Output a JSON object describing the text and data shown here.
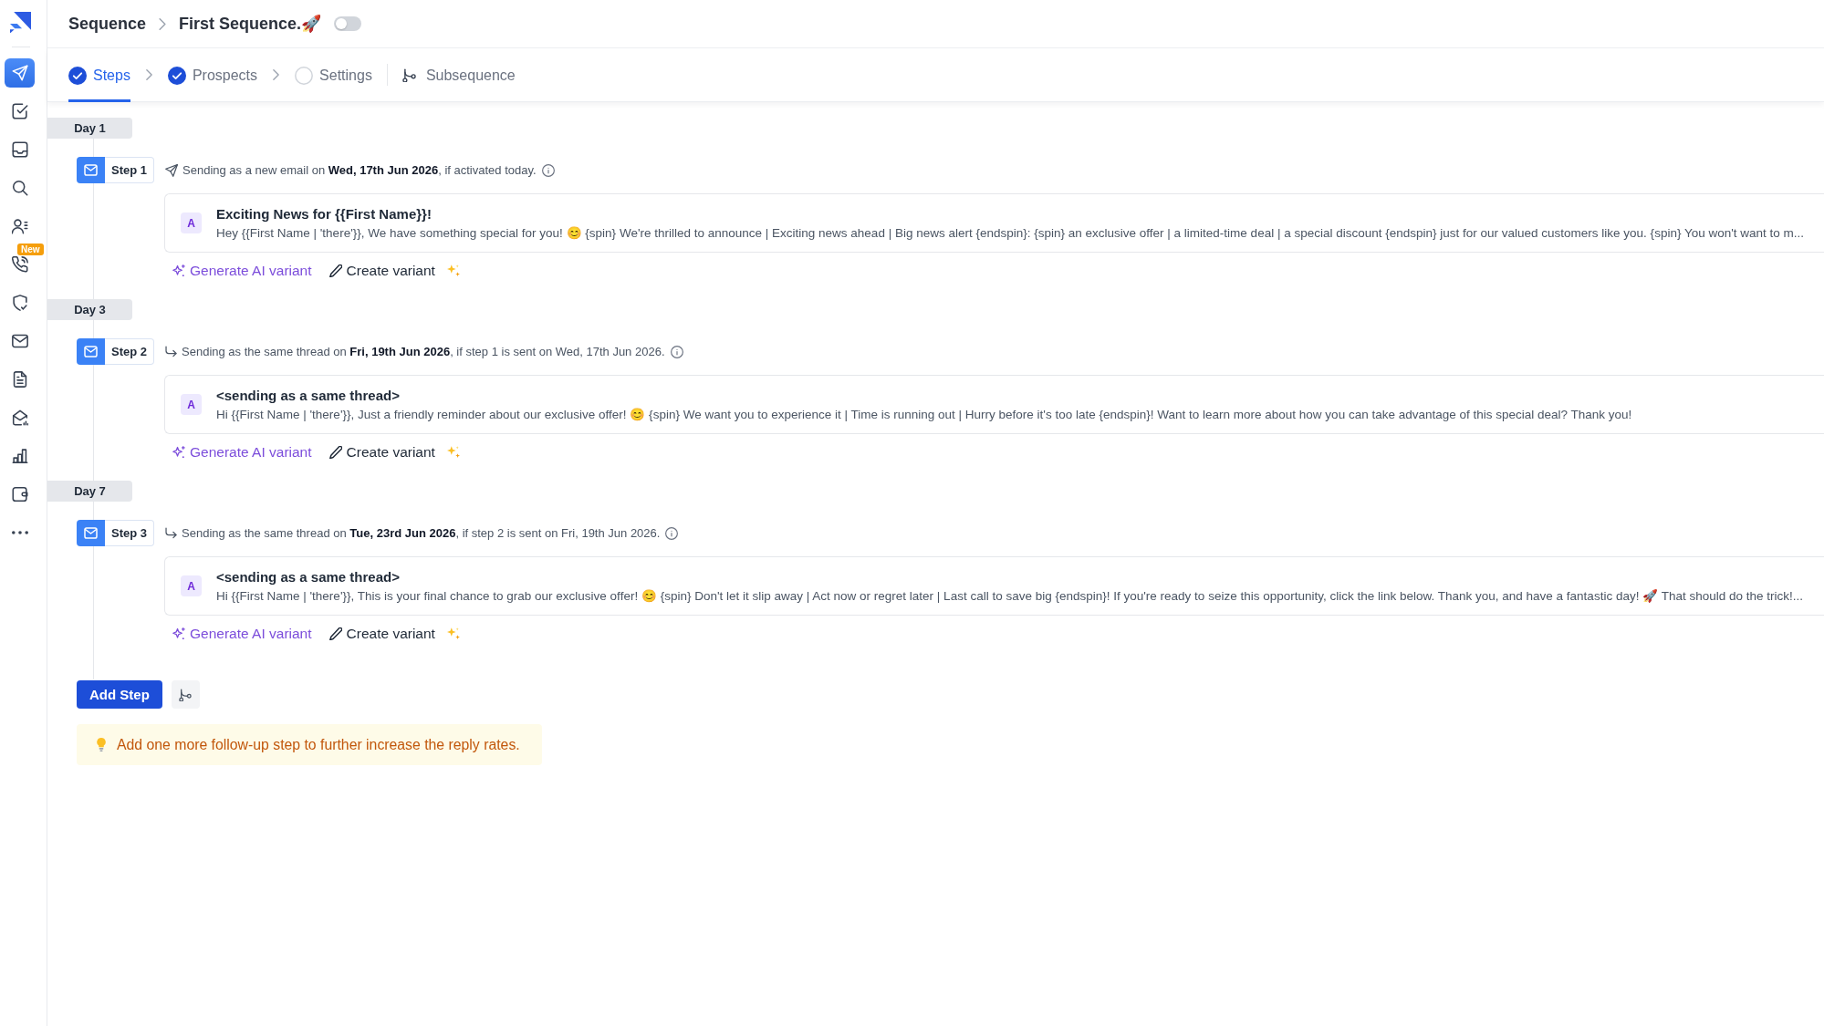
{
  "sidebar": {
    "items": [
      {
        "selected": true
      },
      {
        "selected": false
      },
      {
        "selected": false
      },
      {
        "selected": false
      },
      {
        "selected": false
      },
      {
        "selected": false,
        "badge": "New"
      },
      {
        "selected": false
      },
      {
        "selected": false
      },
      {
        "selected": false
      },
      {
        "selected": false
      },
      {
        "selected": false
      },
      {
        "selected": false
      },
      {
        "selected": false
      }
    ]
  },
  "header": {
    "breadcrumb": [
      "Sequence",
      "First Sequence.🚀"
    ],
    "toggle": {
      "on": false
    }
  },
  "tabs": [
    {
      "kind": "step",
      "label": "Steps",
      "completed": true,
      "selected": true
    },
    {
      "kind": "step",
      "label": "Prospects",
      "completed": true,
      "selected": false
    },
    {
      "kind": "step",
      "label": "Settings",
      "completed": false,
      "selected": false
    },
    {
      "kind": "subsequence",
      "label": "Subsequence",
      "selected": false
    }
  ],
  "days": [
    {
      "label": "Day 1",
      "step": {
        "label": "Step 1",
        "schedule": {
          "kind": "new_email",
          "text": "Sending as a new email on **Wed, 17th Jun 2026**, if activated today."
        },
        "variant": {
          "label": "A",
          "subject": "Exciting News for {{First Name}}!",
          "body": "Hey {{First Name | 'there'}}, We have something special for you! 😊 {spin} We're thrilled to announce | Exciting news ahead | Big news alert {endspin}: {spin} an exclusive offer | a limited-time deal | a special discount {endspin} just for our valued customers like you. {spin} You won't want to m..."
        },
        "actions": [
          {
            "kind": "ai",
            "label": "Generate AI variant"
          },
          {
            "kind": "manual",
            "label": "Create variant"
          }
        ]
      }
    },
    {
      "label": "Day 3",
      "step": {
        "label": "Step 2",
        "schedule": {
          "kind": "same_thread",
          "text": "Sending as the same thread on **Fri, 19th Jun 2026**, if step 1 is sent on Wed, 17th Jun 2026."
        },
        "variant": {
          "label": "A",
          "subject": "<sending as a same thread>",
          "body": "Hi {{First Name | 'there'}}, Just a friendly reminder about our exclusive offer! 😊 {spin} We want you to experience it | Time is running out | Hurry before it's too late {endspin}! Want to learn more about how you can take advantage of this special deal? Thank you!"
        },
        "actions": [
          {
            "kind": "ai",
            "label": "Generate AI variant"
          },
          {
            "kind": "manual",
            "label": "Create variant"
          }
        ]
      }
    },
    {
      "label": "Day 7",
      "step": {
        "label": "Step 3",
        "schedule": {
          "kind": "same_thread",
          "text": "Sending as the same thread on **Tue, 23rd Jun 2026**, if step 2 is sent on Fri, 19th Jun 2026."
        },
        "variant": {
          "label": "A",
          "subject": "<sending as a same thread>",
          "body": "Hi {{First Name | 'there'}}, This is your final chance to grab our exclusive offer! 😊 {spin} Don't let it slip away | Act now or regret later | Last call to save big {endspin}! If you're ready to seize this opportunity, click the link below. Thank you, and have a fantastic day! 🚀 That should do the trick!..."
        },
        "actions": [
          {
            "kind": "ai",
            "label": "Generate AI variant"
          },
          {
            "kind": "manual",
            "label": "Create variant"
          }
        ]
      }
    }
  ],
  "add_step": "Add Step",
  "tip": "Add one more follow-up step to further increase the reply rates."
}
